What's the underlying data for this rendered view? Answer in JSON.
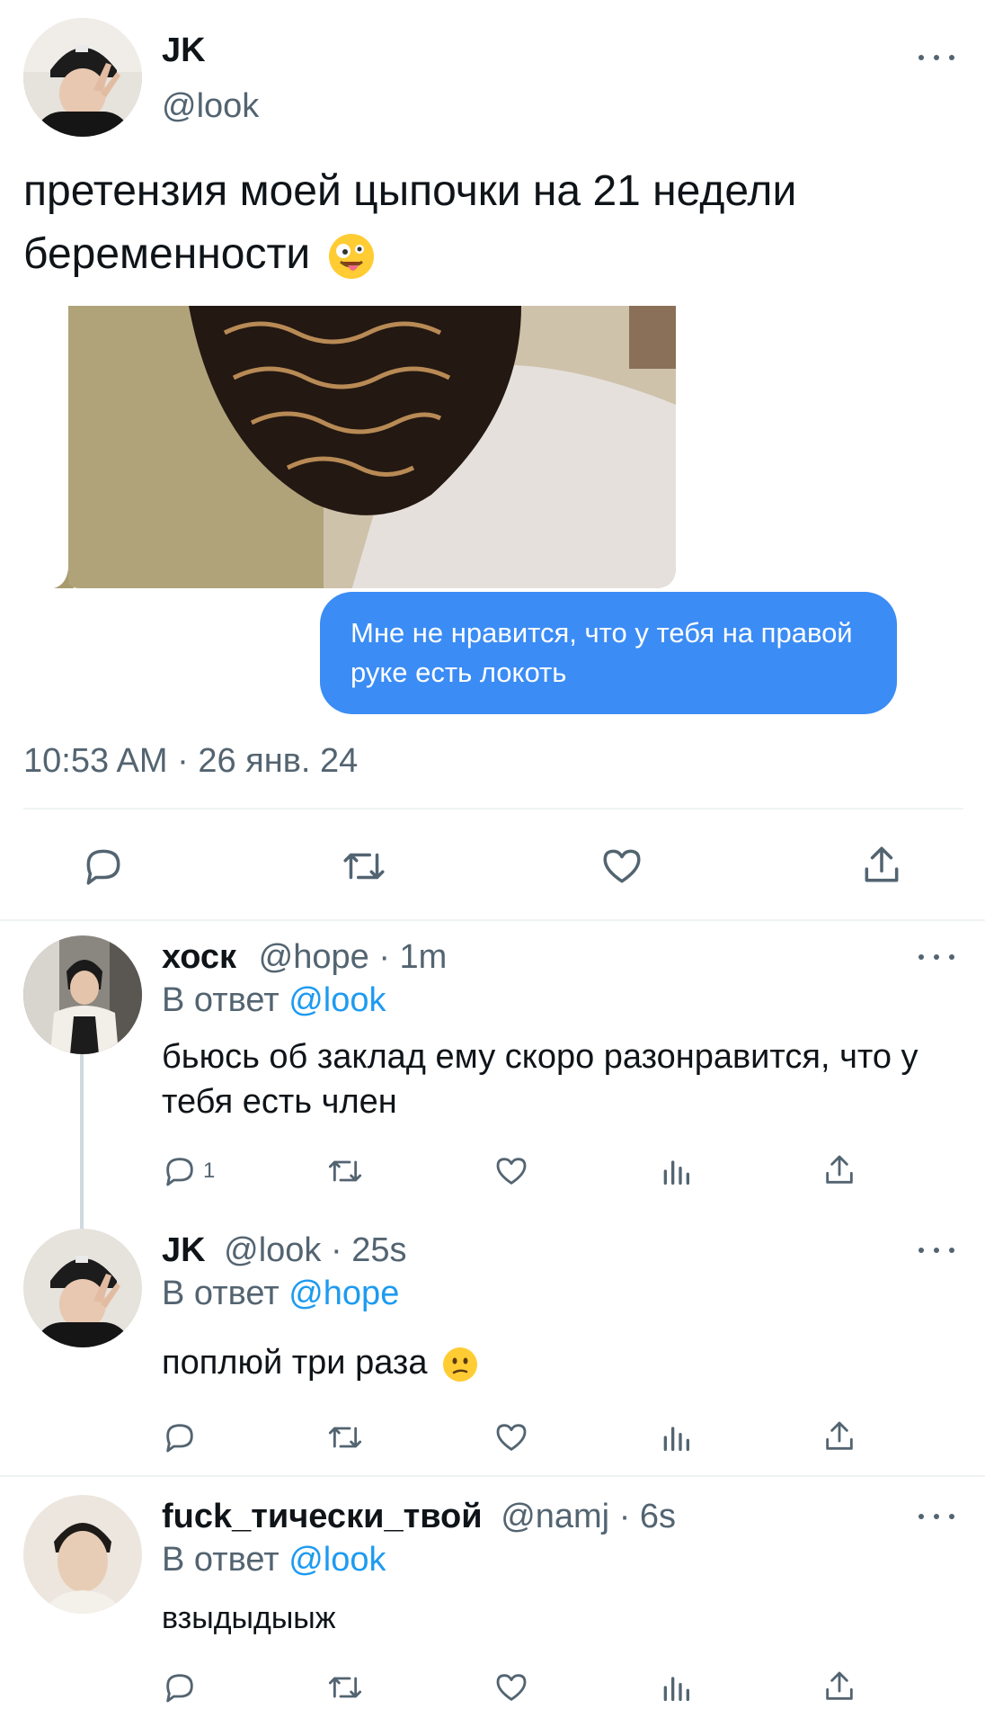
{
  "main_tweet": {
    "display_name": "JK",
    "handle": "@look",
    "text": "претензия моей цыпочки на 21 недели беременности",
    "text_emoji": "zany-face-emoji",
    "chat_bubble_text": "Мне не нравится, что у тебя на правой руке есть локоть",
    "timestamp": "10:53 AM · 26 янв. 24",
    "actions": [
      "reply-icon",
      "retweet-icon",
      "like-icon",
      "share-icon"
    ]
  },
  "replies": [
    {
      "display_name": "хоск",
      "handle": "@hope",
      "time": "· 1m",
      "reply_prefix": "В ответ",
      "reply_to": "@look",
      "text": "бьюсь об заклад ему скоро разонравится, что у тебя есть член",
      "reply_count": "1"
    },
    {
      "display_name": "JK",
      "handle": "@look",
      "time": "· 25s",
      "reply_prefix": "В ответ",
      "reply_to": "@hope",
      "text": "поплюй три раза",
      "text_emoji": "confused-face-emoji"
    },
    {
      "display_name": "fuck_тически_твой",
      "handle": "@namj",
      "time": "· 6s",
      "reply_prefix": "В ответ",
      "reply_to": "@look",
      "text": "взыдыдыыж"
    }
  ],
  "colors": {
    "accent": "#1d9bf0",
    "text": "#0f1419",
    "muted": "#536471",
    "imessage_blue": "#3b8cf5"
  }
}
